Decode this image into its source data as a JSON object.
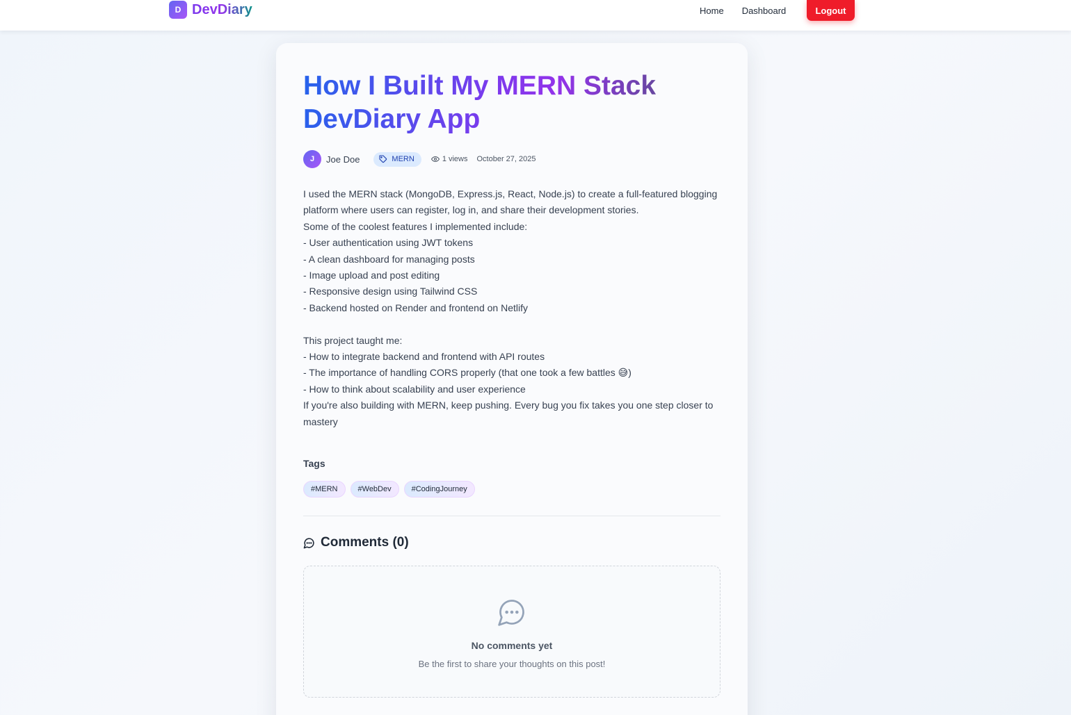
{
  "nav": {
    "logo_letter": "D",
    "brand": "DevDiary",
    "links": [
      "Home",
      "Dashboard"
    ],
    "logout": "Logout"
  },
  "post": {
    "title": "How I Built My MERN Stack DevDiary App",
    "author_initial": "J",
    "author": "Joe Doe",
    "category": "MERN",
    "views": "1 views",
    "date": "October 27, 2025",
    "content": "I used the MERN stack (MongoDB, Express.js, React, Node.js) to create a full-featured blogging platform where users can register, log in, and share their development stories.\nSome of the coolest features I implemented include:\n- User authentication using JWT tokens\n- A clean dashboard for managing posts\n- Image upload and post editing\n- Responsive design using Tailwind CSS\n- Backend hosted on Render and frontend on Netlify\n\nThis project taught me:\n- How to integrate backend and frontend with API routes\n- The importance of handling CORS properly (that one took a few battles 😅)\n- How to think about scalability and user experience\nIf you're also building with MERN, keep pushing. Every bug you fix takes you one step closer to mastery"
  },
  "tags": {
    "heading": "Tags",
    "items": [
      "#MERN",
      "#WebDev",
      "#CodingJourney"
    ]
  },
  "comments": {
    "title": "Comments (0)",
    "empty_title": "No comments yet",
    "empty_subtitle": "Be the first to share your thoughts on this post!"
  },
  "icons": {
    "category": "tag-icon",
    "views": "eye-icon",
    "comments": "chat-bubble-icon",
    "empty": "chat-bubble-dots-icon"
  },
  "colors": {
    "accent": "#7c3aed",
    "logout": "#ef1c2a",
    "category_bg": "#dbeafe"
  }
}
